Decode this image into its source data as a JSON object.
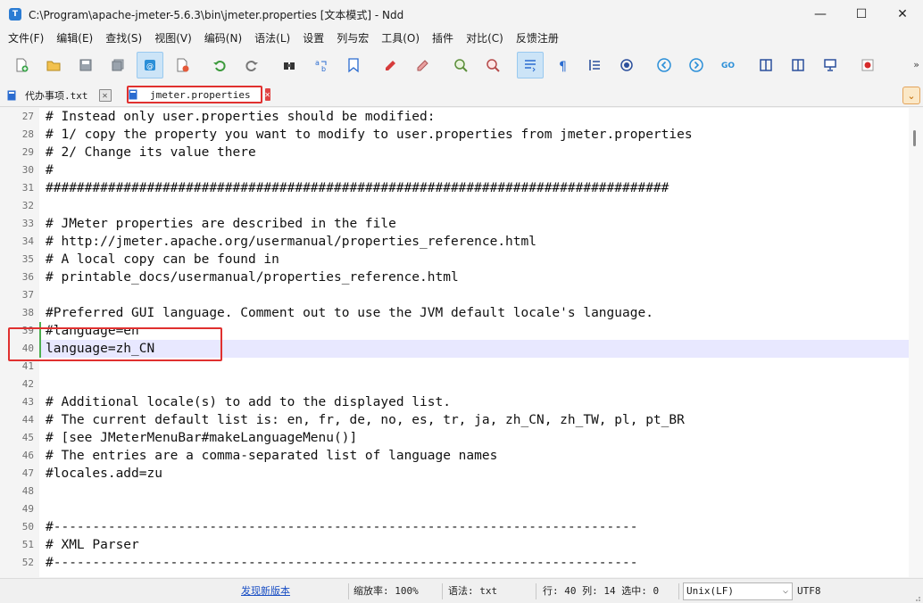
{
  "window": {
    "title": "C:\\Program\\apache-jmeter-5.6.3\\bin\\jmeter.properties [文本模式] - Ndd",
    "app_icon_letter": "T",
    "minimize": "—",
    "maximize": "☐",
    "close": "✕"
  },
  "menu": [
    "文件(F)",
    "编辑(E)",
    "查找(S)",
    "视图(V)",
    "编码(N)",
    "语法(L)",
    "设置",
    "列与宏",
    "工具(O)",
    "插件",
    "对比(C)",
    "反馈注册"
  ],
  "toolbar": {
    "icons": [
      "new-file-icon",
      "open-folder-icon",
      "save-icon",
      "save-all-icon",
      "file-status-icon",
      "close-file-icon",
      "undo-icon",
      "redo-icon",
      "binoculars-icon",
      "replace-icon",
      "bookmark-icon",
      "marker-icon",
      "eraser-icon",
      "zoom-in-icon",
      "zoom-out-icon",
      "word-wrap-icon",
      "pilcrow-icon",
      "indent-guide-icon",
      "target-icon",
      "nav-back-icon",
      "nav-forward-icon",
      "goto-icon",
      "split-horizontal-icon",
      "split-vertical-icon",
      "monitor-icon",
      "record-icon"
    ],
    "more": "»"
  },
  "tabs": [
    {
      "label": "代办事项.txt",
      "active": false,
      "icon_color": "#2b6cd0"
    },
    {
      "label": "jmeter.properties",
      "active": true,
      "icon_color": "#2b6cd0"
    }
  ],
  "editor": {
    "current_line": 40,
    "lines": [
      {
        "n": "27",
        "text": "# Instead only user.properties should be modified:"
      },
      {
        "n": "28",
        "text": "# 1/ copy the property you want to modify to user.properties from jmeter.properties"
      },
      {
        "n": "29",
        "text": "# 2/ Change its value there"
      },
      {
        "n": "30",
        "text": "#"
      },
      {
        "n": "31",
        "text": "################################################################################"
      },
      {
        "n": "32",
        "text": ""
      },
      {
        "n": "33",
        "text": "# JMeter properties are described in the file"
      },
      {
        "n": "34",
        "text": "# http://jmeter.apache.org/usermanual/properties_reference.html"
      },
      {
        "n": "35",
        "text": "# A local copy can be found in"
      },
      {
        "n": "36",
        "text": "# printable_docs/usermanual/properties_reference.html"
      },
      {
        "n": "37",
        "text": ""
      },
      {
        "n": "38",
        "text": "#Preferred GUI language. Comment out to use the JVM default locale's language."
      },
      {
        "n": "39",
        "text": "#language=en"
      },
      {
        "n": "40",
        "text": "language=zh_CN"
      },
      {
        "n": "41",
        "text": ""
      },
      {
        "n": "42",
        "text": ""
      },
      {
        "n": "43",
        "text": "# Additional locale(s) to add to the displayed list."
      },
      {
        "n": "44",
        "text": "# The current default list is: en, fr, de, no, es, tr, ja, zh_CN, zh_TW, pl, pt_BR"
      },
      {
        "n": "45",
        "text": "# [see JMeterMenuBar#makeLanguageMenu()]"
      },
      {
        "n": "46",
        "text": "# The entries are a comma-separated list of language names"
      },
      {
        "n": "47",
        "text": "#locales.add=zu"
      },
      {
        "n": "48",
        "text": ""
      },
      {
        "n": "49",
        "text": ""
      },
      {
        "n": "50",
        "text": "#---------------------------------------------------------------------------"
      },
      {
        "n": "51",
        "text": "# XML Parser"
      },
      {
        "n": "52",
        "text": "#---------------------------------------------------------------------------"
      }
    ]
  },
  "status": {
    "update_link": "发现新版本",
    "zoom": "缩放率: 100%",
    "syntax": "语法: txt",
    "position": "行: 40 列: 14 选中: 0",
    "line_ending": "Unix(LF)",
    "encoding": "UTF8"
  },
  "colors": {
    "highlight_border": "#e0302f",
    "current_line_bg": "#e8e8ff",
    "change_marker": "#4caf50"
  }
}
